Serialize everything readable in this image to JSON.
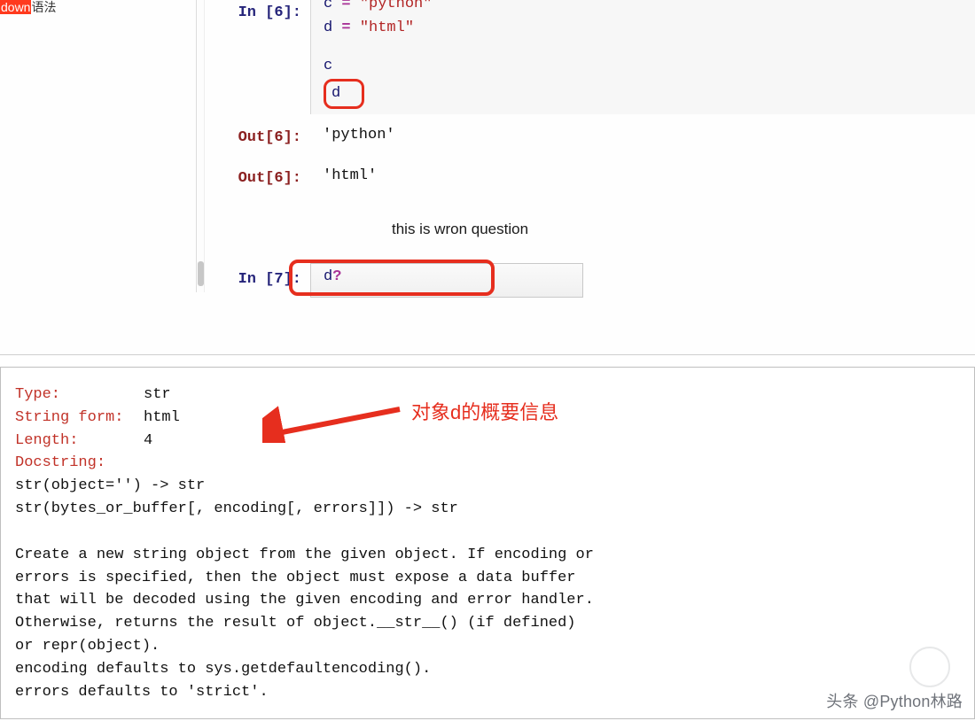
{
  "sidebar": {
    "fragment_hl": "down",
    "fragment_rest": "语法"
  },
  "cells": {
    "in6": {
      "prompt": "In [6]:",
      "line1_var": "c",
      "line1_op": "=",
      "line1_str": "\"python\"",
      "line2_var": "d",
      "line2_op": "=",
      "line2_str": "\"html\"",
      "line3": "c",
      "line4": "d"
    },
    "out6a": {
      "prompt": "Out[6]:",
      "value": "'python'"
    },
    "out6b": {
      "prompt": "Out[6]:",
      "value": "'html'"
    },
    "md": "this is wron question",
    "in7": {
      "prompt": "In [7]:",
      "var": "d",
      "qm": "?"
    }
  },
  "pager": {
    "rows": [
      {
        "label": "Type:",
        "value": "str"
      },
      {
        "label": "String form:",
        "value": "html"
      },
      {
        "label": "Length:",
        "value": "4"
      },
      {
        "label": "Docstring:",
        "value": ""
      }
    ],
    "doc": "str(object='') -> str\nstr(bytes_or_buffer[, encoding[, errors]]) -> str\n\nCreate a new string object from the given object. If encoding or\nerrors is specified, then the object must expose a data buffer\nthat will be decoded using the given encoding and error handler.\nOtherwise, returns the result of object.__str__() (if defined)\nor repr(object).\nencoding defaults to sys.getdefaultencoding().\nerrors defaults to 'strict'."
  },
  "annotation": "对象d的概要信息",
  "watermark": "头条 @Python林路"
}
